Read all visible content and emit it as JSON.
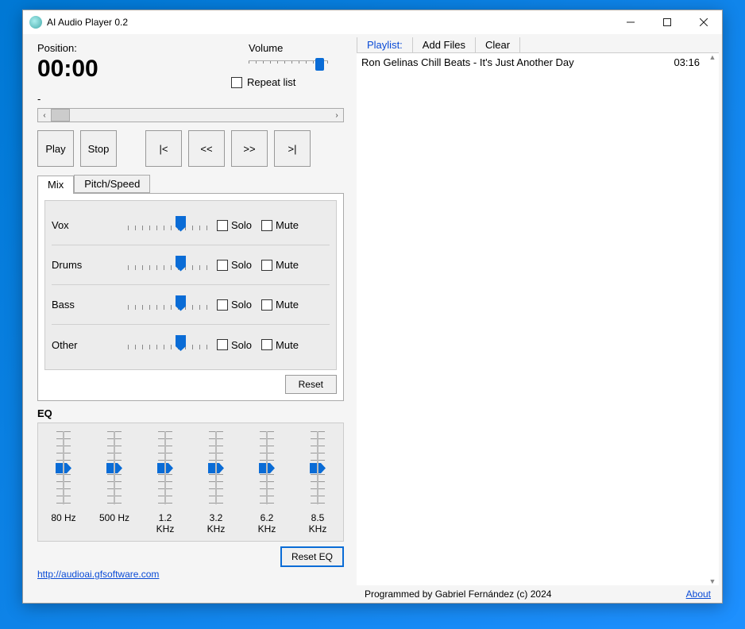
{
  "window": {
    "title": "AI Audio Player 0.2"
  },
  "left": {
    "position_label": "Position:",
    "position_time": "00:00",
    "volume_label": "Volume",
    "repeat_label": "Repeat list",
    "filename": "-",
    "transport": {
      "play": "Play",
      "stop": "Stop",
      "first": "|<",
      "rev": "<<",
      "fwd": ">>",
      "last": ">|"
    },
    "tabs": {
      "mix": "Mix",
      "pitch": "Pitch/Speed"
    },
    "mix": {
      "tracks": [
        {
          "label": "Vox"
        },
        {
          "label": "Drums"
        },
        {
          "label": "Bass"
        },
        {
          "label": "Other"
        }
      ],
      "solo_label": "Solo",
      "mute_label": "Mute",
      "reset": "Reset"
    },
    "eq": {
      "heading": "EQ",
      "bands": [
        "80 Hz",
        "500 Hz",
        "1.2 KHz",
        "3.2 KHz",
        "6.2 KHz",
        "8.5 KHz"
      ],
      "reset": "Reset EQ"
    },
    "link_text": "http://audioai.gfsoftware.com",
    "link_href": "http://audioai.gfsoftware.com"
  },
  "playlist": {
    "tabs": [
      "Playlist:",
      "Add Files",
      "Clear"
    ],
    "items": [
      {
        "title": "Ron Gelinas Chill Beats - It's Just Another Day",
        "duration": "03:16"
      }
    ]
  },
  "footer": {
    "credit": "Programmed by Gabriel Fernández (c) 2024",
    "about": "About"
  }
}
